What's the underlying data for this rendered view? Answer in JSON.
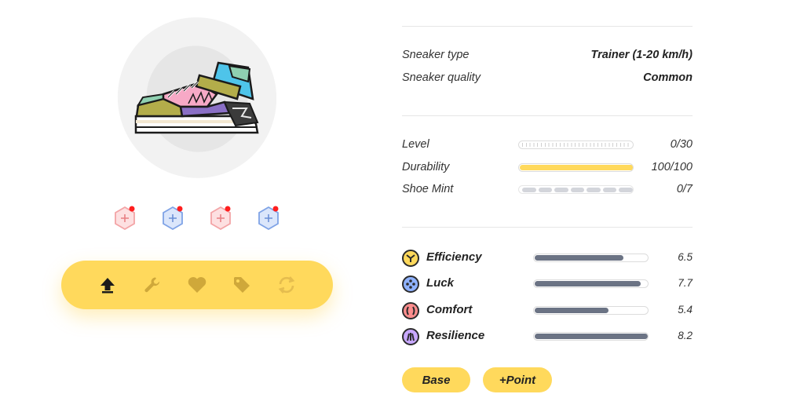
{
  "sneaker": {
    "image_name": "sneaker-trainer",
    "colors": {
      "accent": "#ffd95c",
      "bar": "#6b7384"
    }
  },
  "sockets": [
    {
      "name": "socket-efficiency",
      "color": "#f3a4a6",
      "fill": "#fde0e1",
      "badge": "#ff1e1e"
    },
    {
      "name": "socket-luck",
      "color": "#7fa3e6",
      "fill": "#dbe6fb",
      "badge": "#ff1e1e"
    },
    {
      "name": "socket-comfort",
      "color": "#f3a4a6",
      "fill": "#fde0e1",
      "badge": "#ff1e1e"
    },
    {
      "name": "socket-resilience",
      "color": "#7fa3e6",
      "fill": "#dbe6fb",
      "badge": "#ff1e1e"
    }
  ],
  "actions": [
    {
      "name": "level-up",
      "icon": "arrow-up-icon",
      "active": true
    },
    {
      "name": "repair",
      "icon": "wrench-icon",
      "active": false
    },
    {
      "name": "mint",
      "icon": "heart-icon",
      "active": false
    },
    {
      "name": "sell",
      "icon": "tag-icon",
      "active": false
    },
    {
      "name": "transfer",
      "icon": "refresh-icon",
      "active": false
    }
  ],
  "info": {
    "type_label": "Sneaker type",
    "type_value": "Trainer (1-20 km/h)",
    "quality_label": "Sneaker quality",
    "quality_value": "Common"
  },
  "progress": {
    "level_label": "Level",
    "level_value": "0/30",
    "level_fraction": 0,
    "durability_label": "Durability",
    "durability_value": "100/100",
    "durability_fraction": 1.0,
    "mint_label": "Shoe Mint",
    "mint_value": "0/7",
    "mint_segments": 7,
    "mint_used": 0
  },
  "attributes": [
    {
      "key": "efficiency",
      "label": "Efficiency",
      "value": "6.5",
      "fraction": 0.78,
      "icon_color": "#ffd95c"
    },
    {
      "key": "luck",
      "label": "Luck",
      "value": "7.7",
      "fraction": 0.93,
      "icon_color": "#8fb2ff"
    },
    {
      "key": "comfort",
      "label": "Comfort",
      "value": "5.4",
      "fraction": 0.65,
      "icon_color": "#ff8e8e"
    },
    {
      "key": "resilience",
      "label": "Resilience",
      "value": "8.2",
      "fraction": 0.99,
      "icon_color": "#c8a8ff"
    }
  ],
  "buttons": {
    "base": "Base",
    "point": "+Point"
  }
}
